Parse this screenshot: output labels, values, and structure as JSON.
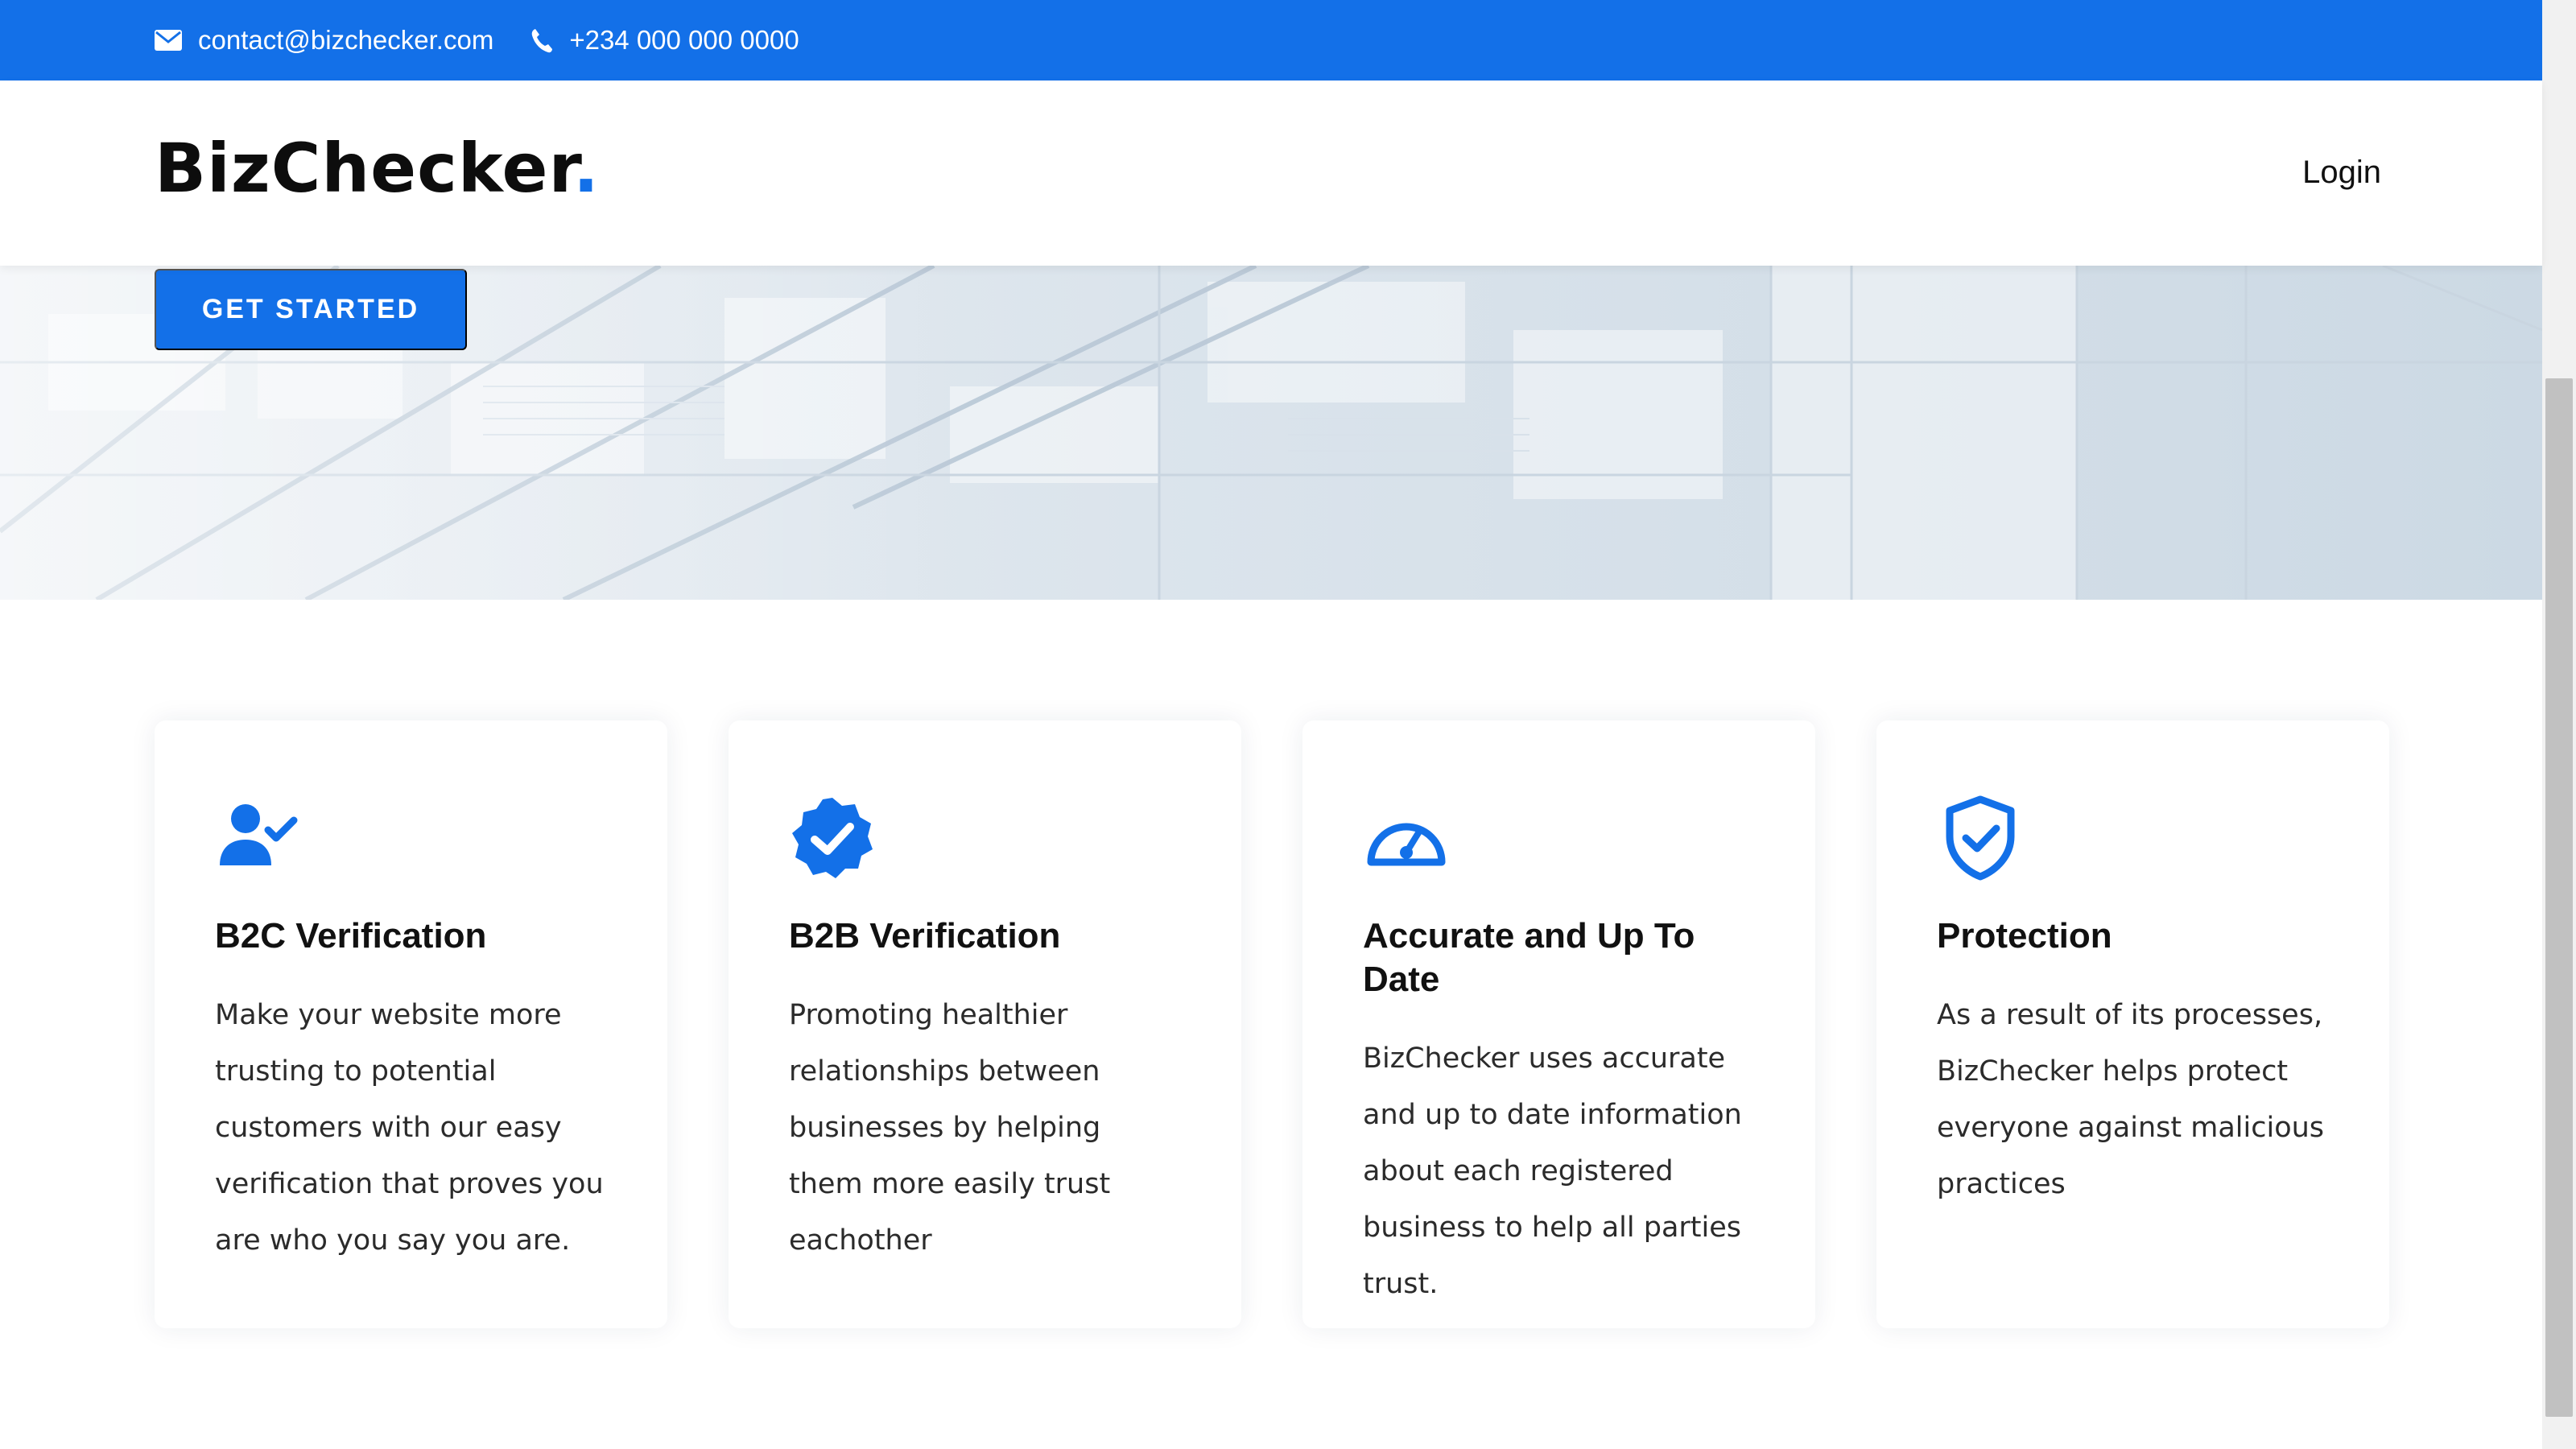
{
  "topbar": {
    "email": "contact@bizchecker.com",
    "phone": "+234 000 000 0000"
  },
  "header": {
    "logo_text": "BizChecker",
    "logo_dot": ".",
    "login_label": "Login"
  },
  "hero": {
    "cta_label": "GET STARTED"
  },
  "features": [
    {
      "icon": "user-check-icon",
      "title": "B2C Verification",
      "text": "Make your website more trusting to potential customers with our easy verification that proves you are who you say you are."
    },
    {
      "icon": "verified-badge-icon",
      "title": "B2B Verification",
      "text": "Promoting healthier relationships between businesses by helping them more easily trust eachother"
    },
    {
      "icon": "speedometer-icon",
      "title": "Accurate and Up To Date",
      "text": "BizChecker uses accurate and up to date information about each registered business to help all parties trust."
    },
    {
      "icon": "shield-check-icon",
      "title": "Protection",
      "text": "As a result of its processes, BizChecker helps protect everyone against malicious practices"
    }
  ],
  "colors": {
    "brand": "#1370e8",
    "text": "#111111"
  }
}
